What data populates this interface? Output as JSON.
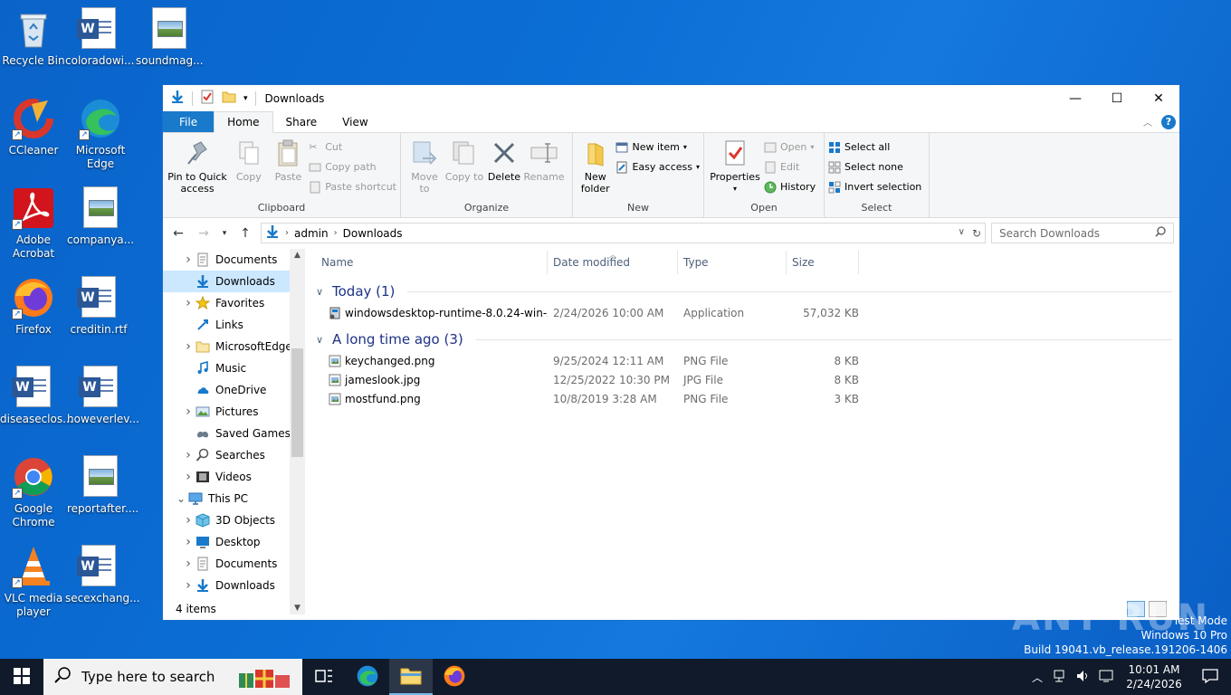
{
  "desktop": {
    "icons": [
      {
        "label": "Recycle Bin"
      },
      {
        "label": "coloradowi..."
      },
      {
        "label": "soundmag..."
      },
      {
        "label": "CCleaner"
      },
      {
        "label": "Microsoft Edge"
      },
      {
        "label": "Adobe Acrobat"
      },
      {
        "label": "companya..."
      },
      {
        "label": "Firefox"
      },
      {
        "label": "creditin.rtf"
      },
      {
        "label": "diseaseclos..."
      },
      {
        "label": "howeverlev..."
      },
      {
        "label": "Google Chrome"
      },
      {
        "label": "reportafter...."
      },
      {
        "label": "VLC media player"
      },
      {
        "label": "secexchang..."
      }
    ]
  },
  "window": {
    "title": "Downloads",
    "controls": {
      "minimize": "—",
      "maximize": "☐",
      "close": "✕"
    }
  },
  "ribbon": {
    "tabs": [
      "File",
      "Home",
      "Share",
      "View"
    ],
    "active_tab": "Home",
    "clipboard": {
      "pin": "Pin to Quick access",
      "copy": "Copy",
      "paste": "Paste",
      "cut": "Cut",
      "copy_path": "Copy path",
      "paste_shortcut": "Paste shortcut",
      "label": "Clipboard"
    },
    "organize": {
      "move_to": "Move to",
      "copy_to": "Copy to",
      "delete": "Delete",
      "rename": "Rename",
      "label": "Organize"
    },
    "new": {
      "new_folder": "New folder",
      "new_item": "New item",
      "easy_access": "Easy access",
      "label": "New"
    },
    "open": {
      "properties": "Properties",
      "open": "Open",
      "edit": "Edit",
      "history": "History",
      "label": "Open"
    },
    "select": {
      "select_all": "Select all",
      "select_none": "Select none",
      "invert": "Invert selection",
      "label": "Select"
    }
  },
  "address": {
    "crumbs": [
      "admin",
      "Downloads"
    ],
    "search_placeholder": "Search Downloads"
  },
  "navpane": {
    "items": [
      {
        "label": "Documents",
        "icon": "documents-icon",
        "expandable": true
      },
      {
        "label": "Downloads",
        "icon": "downloads-icon",
        "expandable": false,
        "selected": true
      },
      {
        "label": "Favorites",
        "icon": "star-icon",
        "expandable": true
      },
      {
        "label": "Links",
        "icon": "links-icon",
        "expandable": false
      },
      {
        "label": "MicrosoftEdge",
        "icon": "folder-icon",
        "expandable": true
      },
      {
        "label": "Music",
        "icon": "music-icon",
        "expandable": false
      },
      {
        "label": "OneDrive",
        "icon": "cloud-icon",
        "expandable": false
      },
      {
        "label": "Pictures",
        "icon": "pictures-icon",
        "expandable": true
      },
      {
        "label": "Saved Games",
        "icon": "games-icon",
        "expandable": false
      },
      {
        "label": "Searches",
        "icon": "search-icon",
        "expandable": true
      },
      {
        "label": "Videos",
        "icon": "videos-icon",
        "expandable": true
      },
      {
        "label": "This PC",
        "icon": "pc-icon",
        "expandable": true,
        "expanded": true
      },
      {
        "label": "3D Objects",
        "icon": "cube-icon",
        "expandable": true,
        "indent": true
      },
      {
        "label": "Desktop",
        "icon": "desktop-icon",
        "expandable": true,
        "indent": true
      },
      {
        "label": "Documents",
        "icon": "documents-icon",
        "expandable": true,
        "indent": true
      },
      {
        "label": "Downloads",
        "icon": "downloads-icon",
        "expandable": true,
        "indent": true
      }
    ]
  },
  "filelist": {
    "columns": [
      "Name",
      "Date modified",
      "Type",
      "Size"
    ],
    "groups": [
      {
        "title": "Today (1)",
        "files": [
          {
            "name": "windowsdesktop-runtime-8.0.24-win-x6...",
            "date": "2/24/2026 10:00 AM",
            "type": "Application",
            "size": "57,032 KB",
            "icon": "installer-icon"
          }
        ]
      },
      {
        "title": "A long time ago (3)",
        "files": [
          {
            "name": "keychanged.png",
            "date": "9/25/2024 12:11 AM",
            "type": "PNG File",
            "size": "8 KB",
            "icon": "image-file-icon"
          },
          {
            "name": "jameslook.jpg",
            "date": "12/25/2022 10:30 PM",
            "type": "JPG File",
            "size": "8 KB",
            "icon": "image-file-icon"
          },
          {
            "name": "mostfund.png",
            "date": "10/8/2019 3:28 AM",
            "type": "PNG File",
            "size": "3 KB",
            "icon": "image-file-icon"
          }
        ]
      }
    ]
  },
  "status": {
    "items_count": "4 items"
  },
  "watermark": {
    "line1": "Test Mode",
    "line2": "Windows 10 Pro",
    "line3": "Build 19041.vb_release.191206-1406",
    "brand": "ANY RUN"
  },
  "taskbar": {
    "search_placeholder": "Type here to search",
    "time": "10:01 AM",
    "date": "2/24/2026"
  },
  "colors": {
    "accent": "#1979ca",
    "selection": "#cce8ff",
    "group_header": "#1e3287"
  }
}
